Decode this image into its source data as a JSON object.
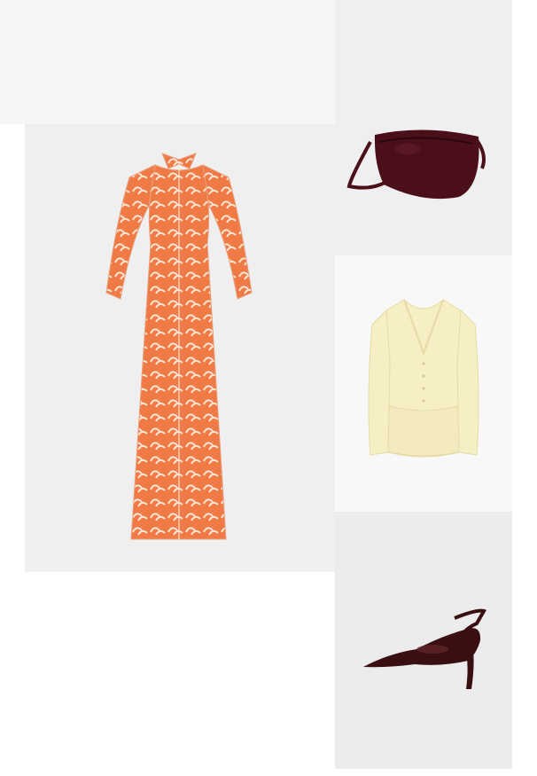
{
  "outfit": {
    "items": [
      {
        "id": "dress",
        "product": "patterned-maxi-shirt-dress"
      },
      {
        "id": "bag",
        "product": "crossbody-half-moon-bag"
      },
      {
        "id": "cardigan",
        "product": "peplum-knit-cardigan"
      },
      {
        "id": "shoes",
        "product": "slingback-pumps"
      }
    ]
  },
  "colors": {
    "page_bg": "#ffffff",
    "card_bg": "#efefef",
    "dress_orange": "#f07a45",
    "dress_cream": "#fbe6d4",
    "bag_burgundy": "#4a0f18",
    "cardigan_cream": "#f6efc4",
    "shoe_burgundy": "#3a0f12"
  }
}
